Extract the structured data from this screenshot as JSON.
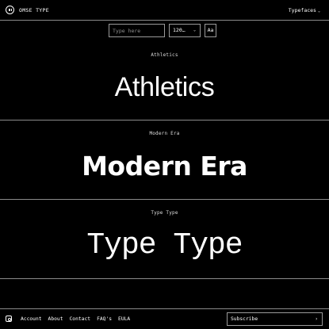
{
  "header": {
    "brand": "OMSE TYPE",
    "nav_typefaces": "Typefaces",
    "nav_chevron": "⌄"
  },
  "controls": {
    "search_placeholder": "Type here",
    "size_value": "120…",
    "size_chevron": "⌄",
    "case_label": "Aa"
  },
  "fonts": [
    {
      "label": "Athletics",
      "sample": "Athletics"
    },
    {
      "label": "Modern Era",
      "sample": "Modern Era"
    },
    {
      "label": "Type Type",
      "sample": "Type Type"
    }
  ],
  "footer": {
    "links": [
      "Account",
      "About",
      "Contact",
      "FAQ's",
      "EULA"
    ],
    "subscribe_placeholder": "Subscribe",
    "subscribe_arrow": "›"
  }
}
